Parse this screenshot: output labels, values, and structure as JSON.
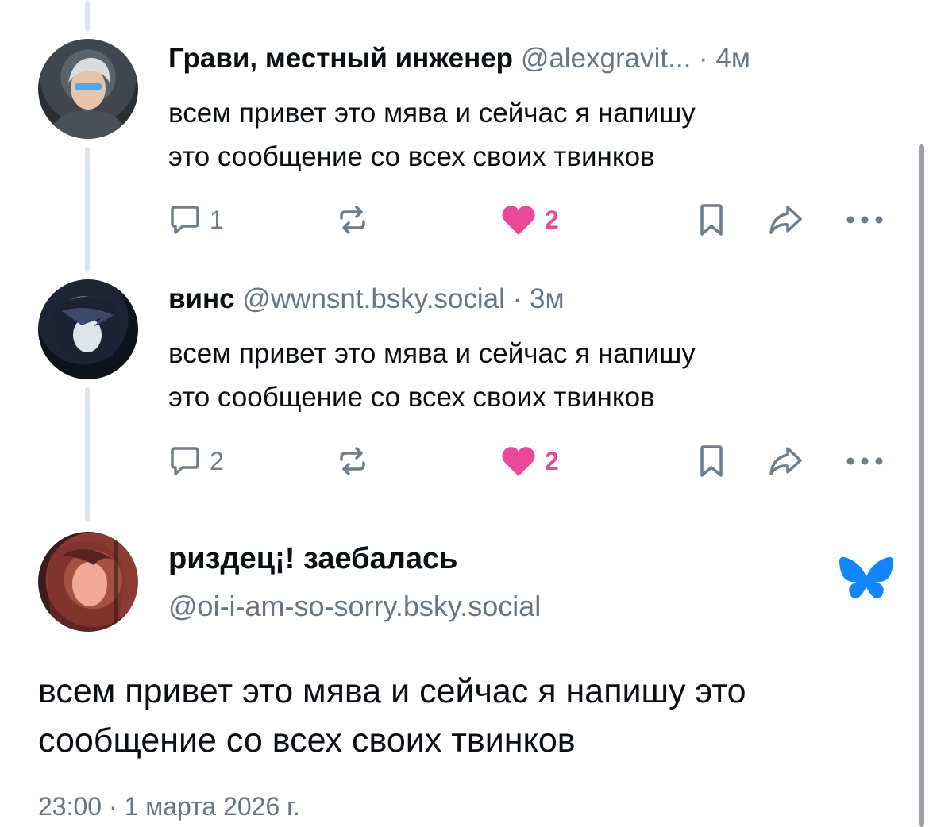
{
  "posts": [
    {
      "author_name": "Грави, местный инженер",
      "handle": "@alexgravit...",
      "time": " · 4м",
      "text_line1": "всем привет это мява и сейчас я напишу",
      "text_line2": "это сообщение со всех своих твинков",
      "reply_count": "1",
      "like_count": "2"
    },
    {
      "author_name": "винс",
      "handle": "@wwnsnt.bsky.social",
      "time": " · 3м",
      "text_line1": "всем привет это мява и сейчас я напишу",
      "text_line2": "это сообщение со всех своих твинков",
      "reply_count": "2",
      "like_count": "2"
    }
  ],
  "main_post": {
    "author_name": "риздец¡! заебалась",
    "handle": "@oi-i-am-so-sorry.bsky.social",
    "text_line1": "всем привет это мява и сейчас я напишу это",
    "text_line2": "сообщение со всех своих твинков",
    "timestamp": "23:00 · 1 марта 2026 г."
  },
  "icons": [
    "reply-icon",
    "repost-icon",
    "heart-icon",
    "bookmark-icon",
    "share-icon",
    "more-icon",
    "bluesky-butterfly-icon"
  ],
  "colors": {
    "like": "#ec4899",
    "brand": "#1185fe",
    "muted": "#687684",
    "thread_line": "#dfe5ec"
  }
}
